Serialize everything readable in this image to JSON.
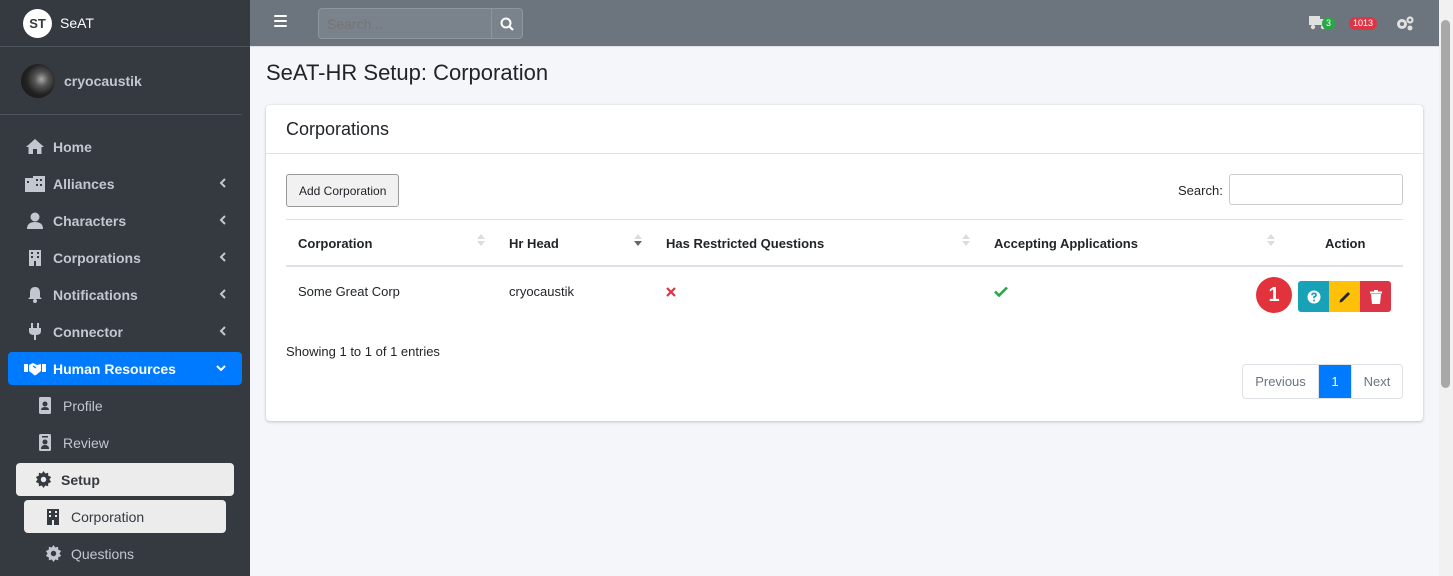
{
  "brand": {
    "logo": "ST",
    "name": "SeAT"
  },
  "user": {
    "name": "cryocaustik"
  },
  "sidebar": {
    "items": [
      {
        "label": "Home",
        "icon": "home-icon"
      },
      {
        "label": "Alliances",
        "icon": "building-icon"
      },
      {
        "label": "Characters",
        "icon": "user-icon"
      },
      {
        "label": "Corporations",
        "icon": "building-icon"
      },
      {
        "label": "Notifications",
        "icon": "bell-icon"
      },
      {
        "label": "Connector",
        "icon": "plug-icon"
      },
      {
        "label": "Human Resources",
        "icon": "handshake-icon"
      },
      {
        "label": "Profile",
        "icon": "id-badge-icon"
      },
      {
        "label": "Review",
        "icon": "id-card-icon"
      },
      {
        "label": "Setup",
        "icon": "gear-icon"
      },
      {
        "label": "Corporation",
        "icon": "building-icon"
      },
      {
        "label": "Questions",
        "icon": "gear-icon"
      }
    ]
  },
  "topbar": {
    "search_placeholder": "Search...",
    "queue_badge": "3",
    "error_badge": "1013"
  },
  "page": {
    "title": "SeAT-HR Setup: Corporation"
  },
  "card": {
    "title": "Corporations",
    "add_button": "Add Corporation",
    "search_label": "Search:",
    "columns": [
      "Corporation",
      "Hr Head",
      "Has Restricted Questions",
      "Accepting Applications",
      "Action"
    ],
    "rows": [
      {
        "corporation": "Some Great Corp",
        "hr_head": "cryocaustik",
        "restricted": "no",
        "accepting": "yes"
      }
    ],
    "marker": "1",
    "info": "Showing 1 to 1 of 1 entries",
    "pagination": {
      "previous": "Previous",
      "current": "1",
      "next": "Next"
    }
  },
  "colors": {
    "primary": "#007bff",
    "sidebar": "#343a40",
    "info": "#17a2b8",
    "warning": "#ffc107",
    "danger": "#dc3545",
    "success": "#28a745"
  }
}
